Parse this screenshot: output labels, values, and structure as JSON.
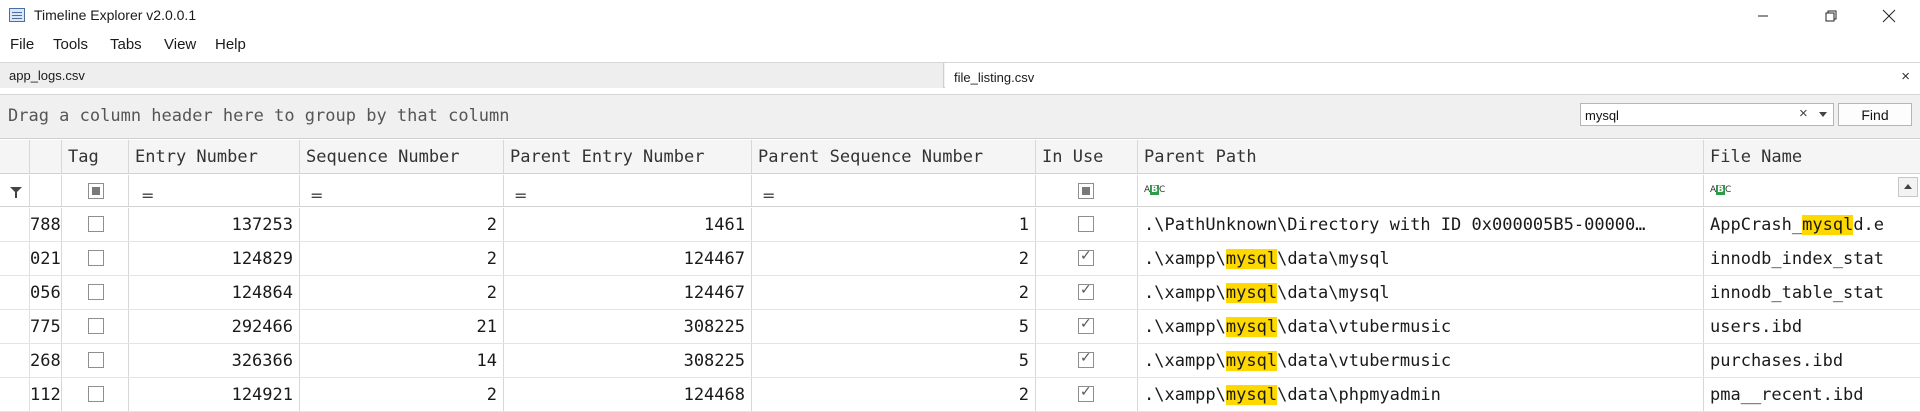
{
  "window": {
    "title": "Timeline Explorer v2.0.0.1",
    "icon": "timeline-explorer-icon",
    "controls": [
      "minimize-icon",
      "restore-icon",
      "close-icon"
    ]
  },
  "menu": [
    "File",
    "Tools",
    "Tabs",
    "View",
    "Help"
  ],
  "tabs": [
    {
      "label": "app_logs.csv",
      "active": false
    },
    {
      "label": "file_listing.csv",
      "active": true
    }
  ],
  "tab_close": "×",
  "group_panel": {
    "hint": "Drag a column header here to group by that column",
    "search_value": "mysql",
    "clear_glyph": "×",
    "find_label": "Find"
  },
  "columns": [
    "Tag",
    "Entry Number",
    "Sequence Number",
    "Parent Entry Number",
    "Parent Sequence Number",
    "In Use",
    "Parent Path",
    "File Name"
  ],
  "filter_glyphs": {
    "equals": "=",
    "text": "ABC"
  },
  "highlight_color": "#ffd800",
  "rows": [
    {
      "id": "788",
      "tag": false,
      "entry": "137253",
      "seq": "2",
      "pentry": "1461",
      "pseq": "1",
      "inuse": false,
      "path": {
        "pre": ".\\PathUnknown\\Directory with ID 0x000005B5-00000…",
        "hit": "",
        "post": ""
      },
      "file": {
        "pre": "AppCrash_",
        "hit": "mysql",
        "post": "d.e"
      }
    },
    {
      "id": "021",
      "tag": false,
      "entry": "124829",
      "seq": "2",
      "pentry": "124467",
      "pseq": "2",
      "inuse": true,
      "path": {
        "pre": ".\\xampp\\",
        "hit": "mysql",
        "post": "\\data\\mysql"
      },
      "file": {
        "pre": "innodb_index_stat",
        "hit": "",
        "post": ""
      }
    },
    {
      "id": "056",
      "tag": false,
      "entry": "124864",
      "seq": "2",
      "pentry": "124467",
      "pseq": "2",
      "inuse": true,
      "path": {
        "pre": ".\\xampp\\",
        "hit": "mysql",
        "post": "\\data\\mysql"
      },
      "file": {
        "pre": "innodb_table_stat",
        "hit": "",
        "post": ""
      }
    },
    {
      "id": "775",
      "tag": false,
      "entry": "292466",
      "seq": "21",
      "pentry": "308225",
      "pseq": "5",
      "inuse": true,
      "path": {
        "pre": ".\\xampp\\",
        "hit": "mysql",
        "post": "\\data\\vtubermusic"
      },
      "file": {
        "pre": "users.ibd",
        "hit": "",
        "post": ""
      }
    },
    {
      "id": "268",
      "tag": false,
      "entry": "326366",
      "seq": "14",
      "pentry": "308225",
      "pseq": "5",
      "inuse": true,
      "path": {
        "pre": ".\\xampp\\",
        "hit": "mysql",
        "post": "\\data\\vtubermusic"
      },
      "file": {
        "pre": "purchases.ibd",
        "hit": "",
        "post": ""
      }
    },
    {
      "id": "112",
      "tag": false,
      "entry": "124921",
      "seq": "2",
      "pentry": "124468",
      "pseq": "2",
      "inuse": true,
      "path": {
        "pre": ".\\xampp\\",
        "hit": "mysql",
        "post": "\\data\\phpmyadmin"
      },
      "file": {
        "pre": "pma__recent.ibd",
        "hit": "",
        "post": ""
      }
    }
  ]
}
